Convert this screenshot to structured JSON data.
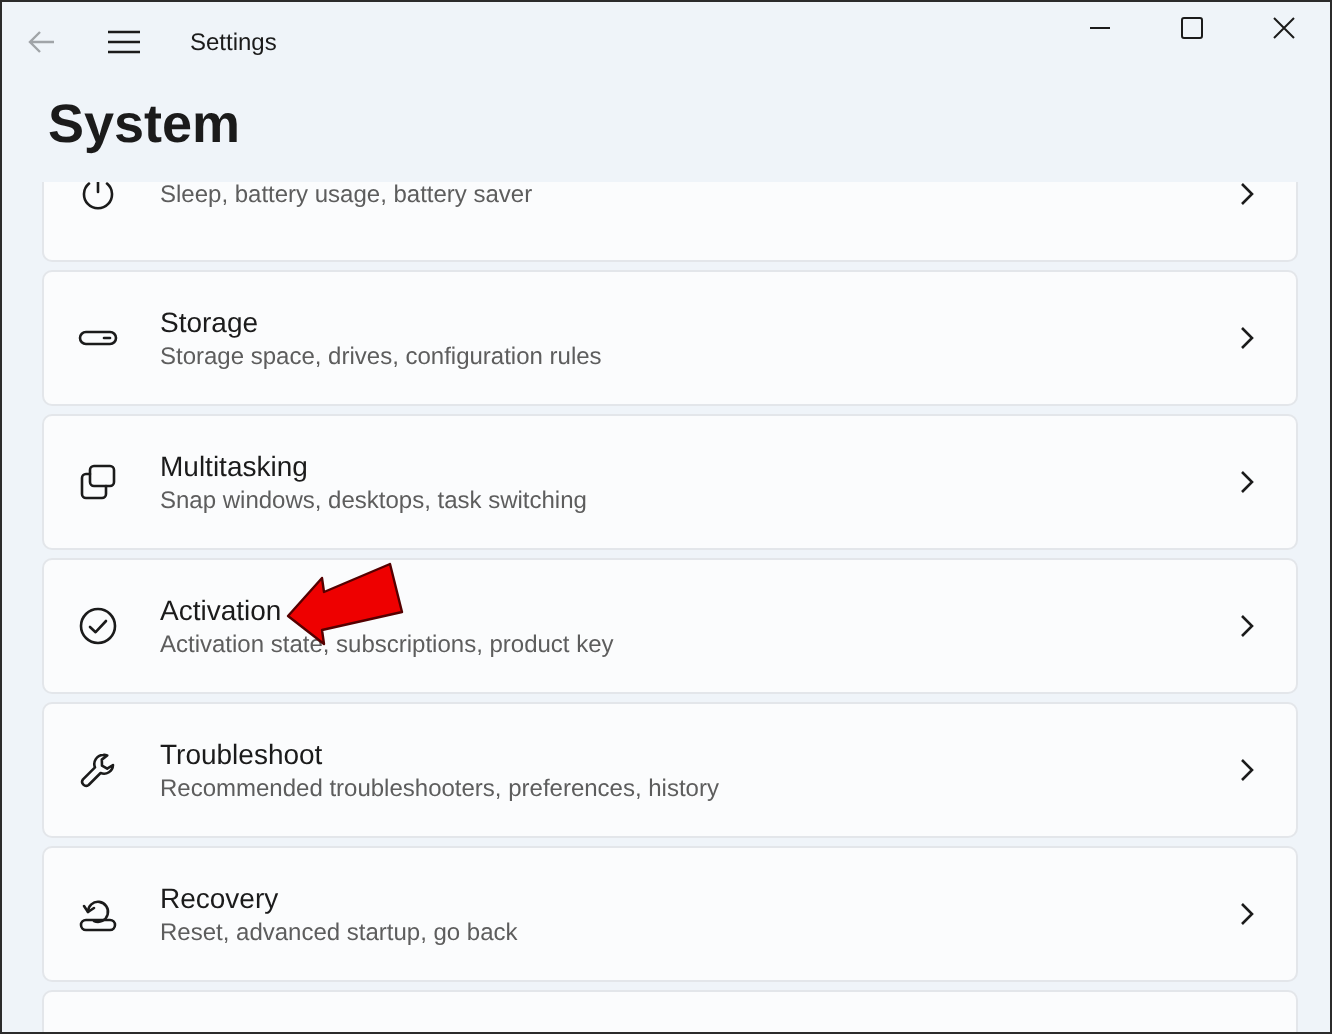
{
  "window": {
    "title": "Settings"
  },
  "page_title": "System",
  "items": [
    {
      "subtitle": "Sleep, battery usage, battery saver"
    },
    {
      "title": "Storage",
      "subtitle": "Storage space, drives, configuration rules"
    },
    {
      "title": "Multitasking",
      "subtitle": "Snap windows, desktops, task switching"
    },
    {
      "title": "Activation",
      "subtitle": "Activation state, subscriptions, product key",
      "arrow": true
    },
    {
      "title": "Troubleshoot",
      "subtitle": "Recommended troubleshooters, preferences, history"
    },
    {
      "title": "Recovery",
      "subtitle": "Reset, advanced startup, go back"
    }
  ]
}
